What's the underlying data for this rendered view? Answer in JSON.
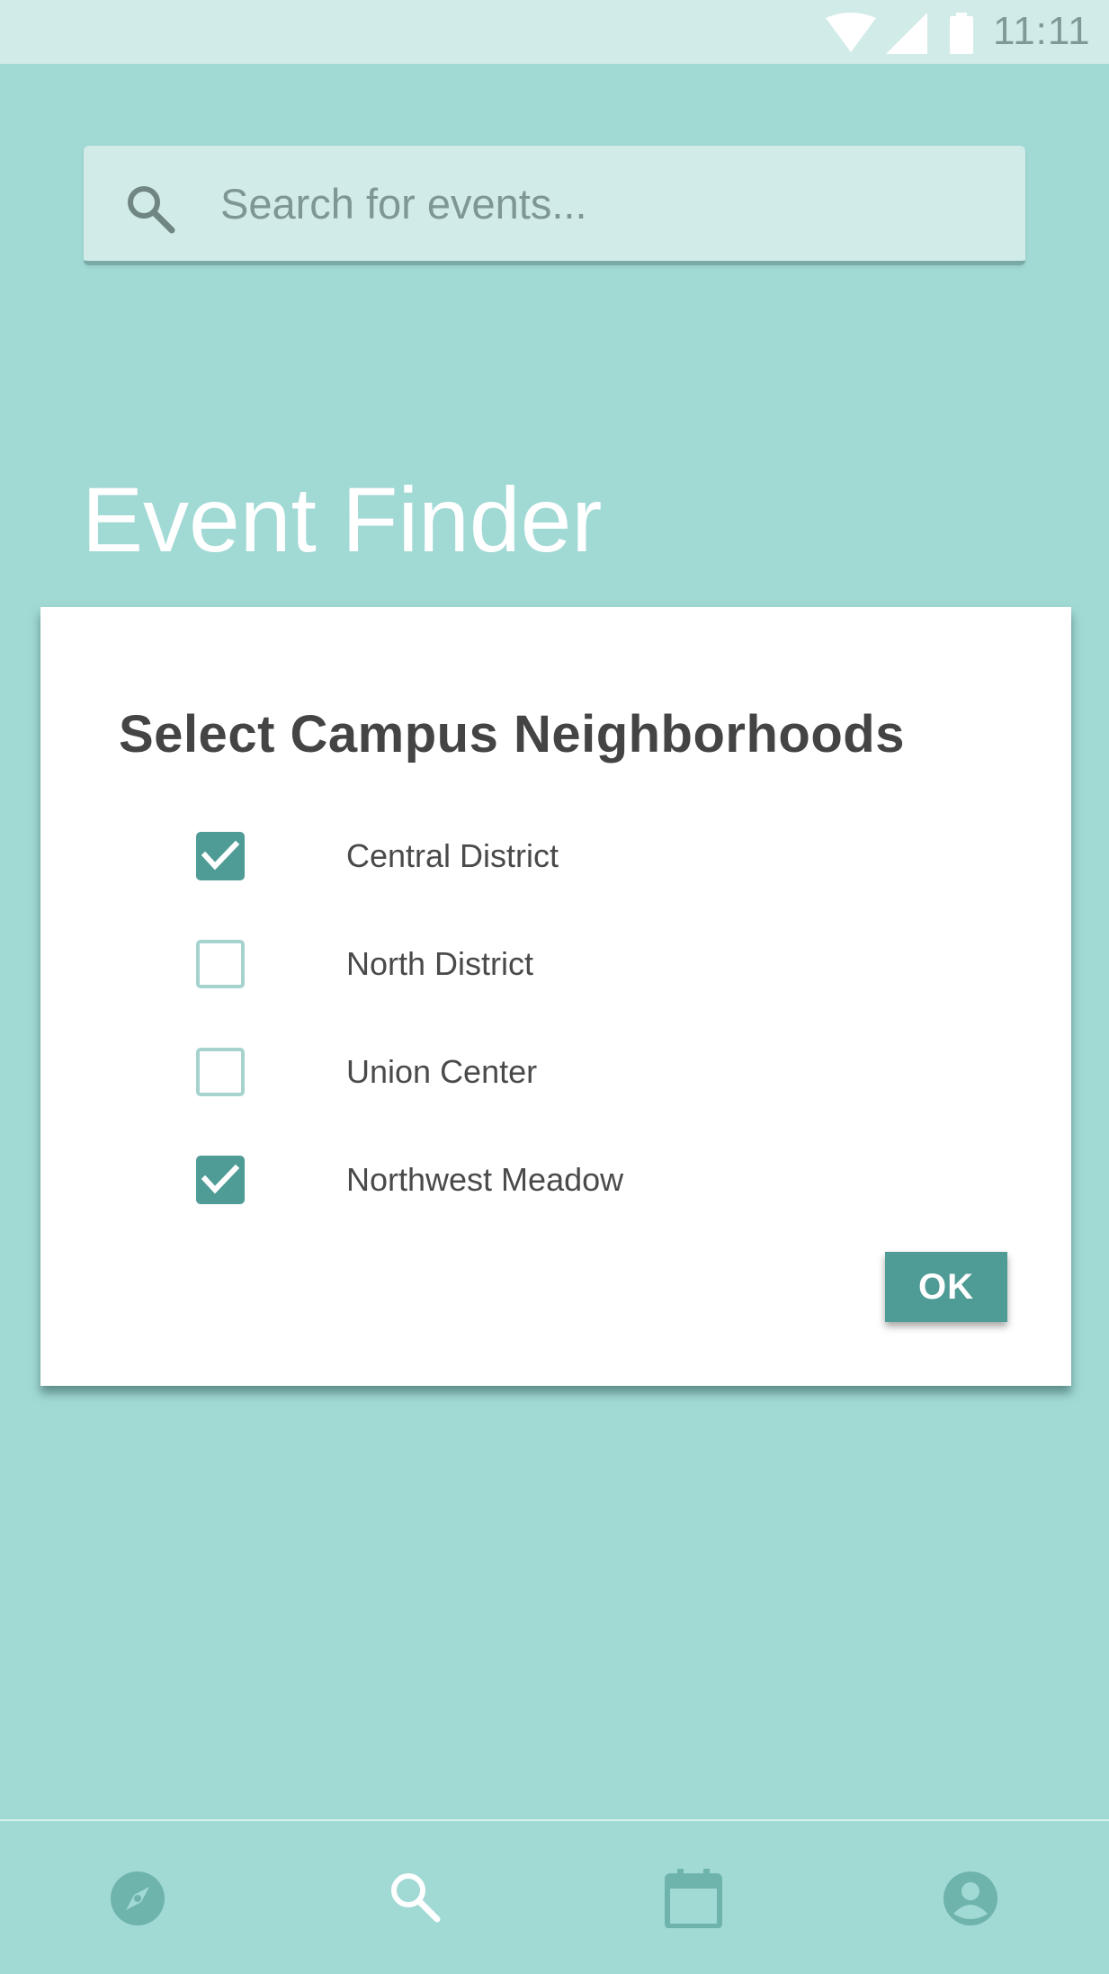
{
  "status_bar": {
    "time": "11:11",
    "icons": [
      "wifi-icon",
      "cell-signal-icon",
      "battery-icon"
    ]
  },
  "search": {
    "placeholder": "Search for events...",
    "value": "",
    "icon": "search-icon"
  },
  "header": {
    "title": "Event Finder"
  },
  "dialog": {
    "title": "Select Campus Neighborhoods",
    "options": [
      {
        "label": "Central District",
        "checked": true
      },
      {
        "label": "North District",
        "checked": false
      },
      {
        "label": "Union Center",
        "checked": false
      },
      {
        "label": "Northwest Meadow",
        "checked": true
      }
    ],
    "ok_label": "OK"
  },
  "bottom_nav": {
    "items": [
      {
        "icon": "compass-icon",
        "active": false
      },
      {
        "icon": "search-icon",
        "active": true
      },
      {
        "icon": "calendar-icon",
        "active": false
      },
      {
        "icon": "account-icon",
        "active": false
      }
    ]
  },
  "colors": {
    "background": "#a1d9d4",
    "surface_light": "#d0ebe8",
    "accent": "#4f9b95",
    "nav_icon": "#6fb3ad",
    "nav_icon_active": "#ffffff"
  }
}
